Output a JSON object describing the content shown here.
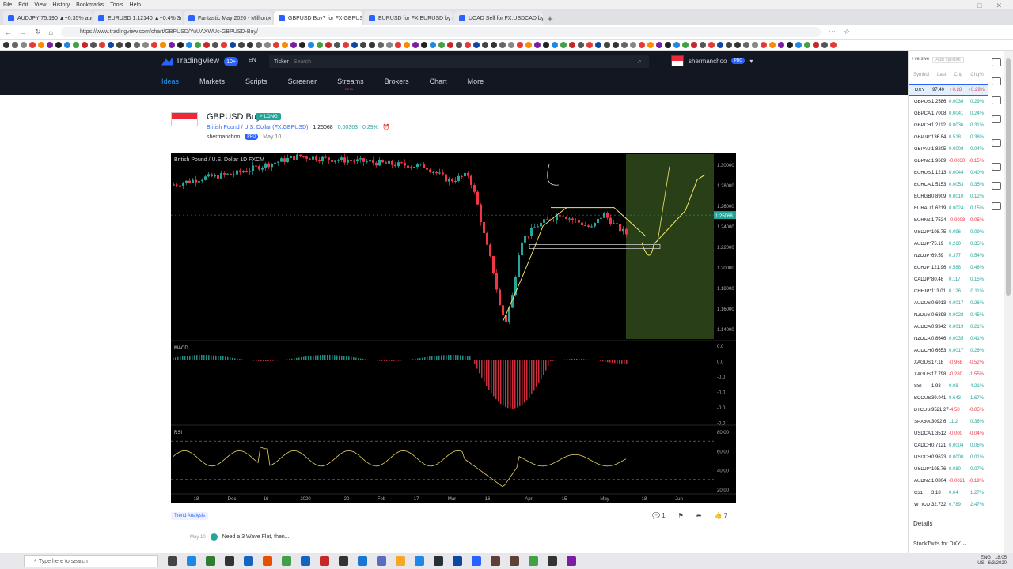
{
  "browser": {
    "menu": [
      "File",
      "Edit",
      "View",
      "History",
      "Bookmarks",
      "Tools",
      "Help"
    ],
    "tabs": [
      {
        "label": "AUDJPY 75.190 ▲+0.35% audjpy"
      },
      {
        "label": "EURUSD 1.12140 ▲+0.4% 3rd"
      },
      {
        "label": "Fantastic May 2020 - Million"
      },
      {
        "label": "GBPUSD Buy? for FX:GBPUSD"
      },
      {
        "label": "EURUSD for FX:EURUSD by sha"
      },
      {
        "label": "UCAD Sell for FX:USDCAD by"
      }
    ],
    "url": "https://www.tradingview.com/chart/GBPUSD/YuUAXWUc-GBPUSD-Buy/",
    "new_tab": "+"
  },
  "tv": {
    "logo": "TradingView",
    "notif_count": "10+",
    "lang": "EN",
    "ticker_label": "Ticker",
    "search_placeholder": "Search",
    "username": "shermanchoo",
    "pro_badge": "PRO",
    "nav": [
      {
        "label": "Ideas"
      },
      {
        "label": "Markets"
      },
      {
        "label": "Scripts"
      },
      {
        "label": "Screener"
      },
      {
        "label": "Streams",
        "beta": "BETA"
      },
      {
        "label": "Brokers"
      },
      {
        "label": "Chart"
      },
      {
        "label": "More"
      }
    ]
  },
  "idea": {
    "title": "GBPUSD Buy?",
    "badge": "↗ LONG",
    "symbol": "British Pound / U.S. Dollar (FX:GBPUSD)",
    "price": "1.25068",
    "change": "0.00363",
    "change_pct": "0.29%",
    "author": "shermanchoo",
    "author_badge": "PRO",
    "date": "May 10",
    "tag": "Trend Analysis",
    "comments": "1",
    "likes": "7",
    "update_date": "May 10",
    "update_text": "Need a 3 Wave Flat, then..."
  },
  "chart_data": {
    "type": "line",
    "title": "British Pound / U.S. Dollar  1D  FXCM",
    "x": [
      "18",
      "Dec",
      "16",
      "2020",
      "20",
      "Feb",
      "17",
      "Mar",
      "16",
      "Apr",
      "15",
      "May",
      "18",
      "Jun"
    ],
    "price_ticks": [
      "1.30000",
      "1.28000",
      "1.26000",
      "1.24000",
      "1.22000",
      "1.20000",
      "1.18000",
      "1.16000",
      "1.14000"
    ],
    "last_price": "1.25068",
    "ylim": [
      1.13,
      1.31
    ],
    "macd_label": "MACD",
    "macd_ticks": [
      "0.0",
      "0.0",
      "-0.0",
      "-0.0",
      "-0.0",
      "-0.0"
    ],
    "rsi_label": "RSI",
    "rsi_ticks": [
      "80.00",
      "60.00",
      "40.00",
      "20.00"
    ]
  },
  "watchlist": {
    "top": {
      "symbol_input": "+ve swe",
      "add_symbol": "Add symbol"
    },
    "headers": [
      "Symbol",
      "Last",
      "Chg",
      "Chg%"
    ],
    "rows": [
      {
        "s": "DXY",
        "l": "97.40",
        "c": "+0.28",
        "p": "+0.29%",
        "dir": "dn",
        "sel": true
      },
      {
        "s": "GBPUSD",
        "l": "1.2586",
        "c": "0.0036",
        "p": "0.29%",
        "dir": "up"
      },
      {
        "s": "GBPCAD",
        "l": "1.7008",
        "c": "0.0041",
        "p": "0.24%",
        "dir": "up"
      },
      {
        "s": "GBPCHF",
        "l": "1.2112",
        "c": "0.0036",
        "p": "0.31%",
        "dir": "up"
      },
      {
        "s": "GBPJPY",
        "l": "136.84",
        "c": "0.518",
        "p": "0.38%",
        "dir": "up"
      },
      {
        "s": "GBPAUD",
        "l": "1.8205",
        "c": "0.0008",
        "p": "0.04%",
        "dir": "up"
      },
      {
        "s": "GBPNZD",
        "l": "1.9669",
        "c": "-0.0030",
        "p": "-0.15%",
        "dir": "dn"
      },
      {
        "s": "EURUSD",
        "l": "1.1213",
        "c": "0.0044",
        "p": "0.40%",
        "dir": "up"
      },
      {
        "s": "EURCAD",
        "l": "1.5153",
        "c": "0.0053",
        "p": "0.35%",
        "dir": "up"
      },
      {
        "s": "EURGBP",
        "l": "0.8909",
        "c": "0.0010",
        "p": "0.12%",
        "dir": "up"
      },
      {
        "s": "EURAUD",
        "l": "1.6219",
        "c": "0.0024",
        "p": "0.15%",
        "dir": "up"
      },
      {
        "s": "EURNZD",
        "l": "1.7524",
        "c": "-0.0008",
        "p": "-0.05%",
        "dir": "dn"
      },
      {
        "s": "USDJPY",
        "l": "108.75",
        "c": "0.096",
        "p": "0.09%",
        "dir": "up"
      },
      {
        "s": "AUDJPY",
        "l": "75.19",
        "c": "0.260",
        "p": "0.35%",
        "dir": "up"
      },
      {
        "s": "NZDJPY",
        "l": "69.59",
        "c": "0.377",
        "p": "0.54%",
        "dir": "up"
      },
      {
        "s": "EURJPY",
        "l": "121.96",
        "c": "0.588",
        "p": "0.48%",
        "dir": "up"
      },
      {
        "s": "CADJPY",
        "l": "80.48",
        "c": "0.117",
        "p": "0.15%",
        "dir": "up"
      },
      {
        "s": "CHFJPY",
        "l": "113.01",
        "c": "0.126",
        "p": "0.11%",
        "dir": "up"
      },
      {
        "s": "AUDUSD",
        "l": "0.6913",
        "c": "0.0017",
        "p": "0.26%",
        "dir": "up"
      },
      {
        "s": "NZDUSD",
        "l": "0.6398",
        "c": "0.0028",
        "p": "0.45%",
        "dir": "up"
      },
      {
        "s": "AUDCAD",
        "l": "0.9342",
        "c": "0.0019",
        "p": "0.21%",
        "dir": "up"
      },
      {
        "s": "NZDCAD",
        "l": "0.8646",
        "c": "0.0035",
        "p": "0.41%",
        "dir": "up"
      },
      {
        "s": "AUDCHF",
        "l": "0.6653",
        "c": "0.0017",
        "p": "0.26%",
        "dir": "up"
      },
      {
        "s": "XAGUSD",
        "l": "17.18",
        "c": "-0.968",
        "p": "-0.52%",
        "dir": "dn"
      },
      {
        "s": "XAGUSD",
        "l": "17.798",
        "c": "-0.280",
        "p": "-1.55%",
        "dir": "dn"
      },
      {
        "s": "SSI",
        "l": "1.93",
        "c": "0.08",
        "p": "4.21%",
        "dir": "up"
      },
      {
        "s": "BCOUSD",
        "l": "39.041",
        "c": "0.643",
        "p": "1.67%",
        "dir": "up"
      },
      {
        "s": "BTCUSD",
        "l": "9521.27",
        "c": "-4.50",
        "p": "-0.05%",
        "dir": "dn"
      },
      {
        "s": "SPX500",
        "l": "3092.6",
        "c": "11.2",
        "p": "0.36%",
        "dir": "up"
      },
      {
        "s": "USDCAD",
        "l": "1.3512",
        "c": "-0.000",
        "p": "-0.04%",
        "dir": "dn"
      },
      {
        "s": "CADCHF",
        "l": "0.7121",
        "c": "0.0004",
        "p": "0.06%",
        "dir": "up"
      },
      {
        "s": "USDCHF",
        "l": "0.9623",
        "c": "0.0000",
        "p": "0.01%",
        "dir": "up"
      },
      {
        "s": "USDJPY",
        "l": "108.76",
        "c": "0.080",
        "p": "0.07%",
        "dir": "up"
      },
      {
        "s": "AUDNZD",
        "l": "1.0804",
        "c": "-0.0021",
        "p": "-0.19%",
        "dir": "dn"
      },
      {
        "s": "C31",
        "l": "3.18",
        "c": "0.04",
        "p": "1.27%",
        "dir": "up"
      },
      {
        "s": "WTICO",
        "l": "32.732",
        "c": "0.789",
        "p": "2.47%",
        "dir": "up"
      }
    ],
    "details": "Details",
    "stocktwits": "StockTwits for DXY ⌄"
  },
  "taskbar": {
    "search_placeholder": "Type here to search",
    "lang": "ENG",
    "region": "US",
    "time": "18:05",
    "date": "6/3/2020"
  },
  "colors": {
    "tv_bg": "#131722",
    "accent": "#2962ff",
    "up": "#26a69a",
    "down": "#f23645"
  }
}
